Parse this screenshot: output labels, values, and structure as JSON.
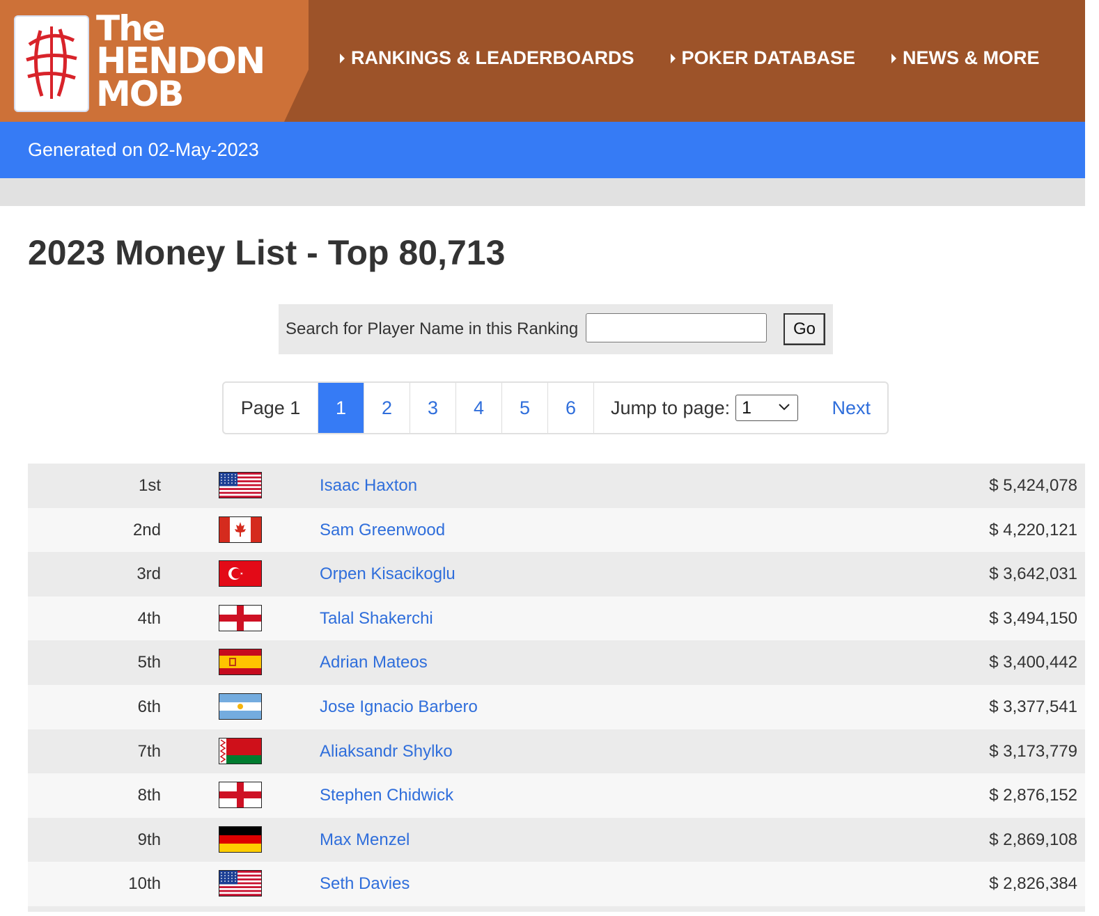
{
  "header": {
    "logo": {
      "line1": "The",
      "line2": "HENDON",
      "line3": "MOB"
    },
    "nav": [
      {
        "label": "RANKINGS & LEADERBOARDS"
      },
      {
        "label": "POKER DATABASE"
      },
      {
        "label": "NEWS & MORE"
      }
    ],
    "colors": {
      "bar": "#9d5329",
      "logo_bg": "#cd7138"
    }
  },
  "generated": {
    "text": "Generated on 02-May-2023",
    "color": "#367bf5"
  },
  "page_title": "2023 Money List - Top 80,713",
  "search": {
    "label": "Search for Player Name in this Ranking",
    "value": "",
    "button": "Go"
  },
  "pagination": {
    "label": "Page 1",
    "pages": [
      "1",
      "2",
      "3",
      "4",
      "5",
      "6"
    ],
    "active_page": "1",
    "jump_label": "Jump to page:",
    "jump_value": "1",
    "next": "Next"
  },
  "rankings": [
    {
      "rank": "1st",
      "country": "usa",
      "name": "Isaac Haxton",
      "amount": "$ 5,424,078"
    },
    {
      "rank": "2nd",
      "country": "canada",
      "name": "Sam Greenwood",
      "amount": "$ 4,220,121"
    },
    {
      "rank": "3rd",
      "country": "turkey",
      "name": "Orpen Kisacikoglu",
      "amount": "$ 3,642,031"
    },
    {
      "rank": "4th",
      "country": "england",
      "name": "Talal Shakerchi",
      "amount": "$ 3,494,150"
    },
    {
      "rank": "5th",
      "country": "spain",
      "name": "Adrian Mateos",
      "amount": "$ 3,400,442"
    },
    {
      "rank": "6th",
      "country": "argentina",
      "name": "Jose Ignacio Barbero",
      "amount": "$ 3,377,541"
    },
    {
      "rank": "7th",
      "country": "belarus",
      "name": "Aliaksandr Shylko",
      "amount": "$ 3,173,779"
    },
    {
      "rank": "8th",
      "country": "england",
      "name": "Stephen Chidwick",
      "amount": "$ 2,876,152"
    },
    {
      "rank": "9th",
      "country": "germany",
      "name": "Max Menzel",
      "amount": "$ 2,869,108"
    },
    {
      "rank": "10th",
      "country": "usa",
      "name": "Seth Davies",
      "amount": "$ 2,826,384"
    }
  ]
}
